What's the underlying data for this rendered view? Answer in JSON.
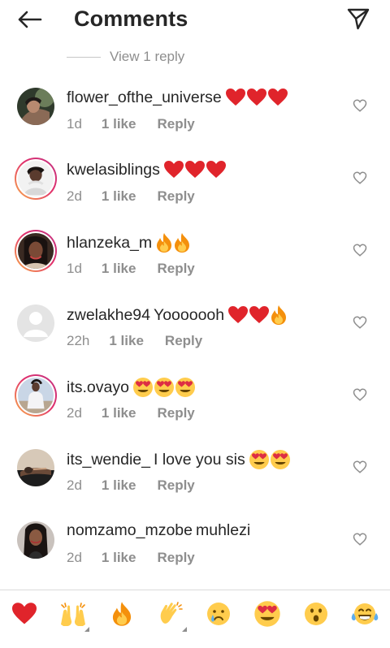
{
  "header": {
    "title": "Comments"
  },
  "view_replies": {
    "label": "View 1 reply"
  },
  "comments": [
    {
      "username": "flower_ofthe_universe",
      "text": "",
      "emojis": [
        "red-heart",
        "red-heart",
        "red-heart"
      ],
      "time": "1d",
      "likes": "1 like",
      "reply": "Reply",
      "avatar_ring": false
    },
    {
      "username": "kwelasiblings",
      "text": "",
      "emojis": [
        "red-heart",
        "red-heart",
        "red-heart"
      ],
      "time": "2d",
      "likes": "1 like",
      "reply": "Reply",
      "avatar_ring": true
    },
    {
      "username": "hlanzeka_m",
      "text": "",
      "emojis": [
        "fire",
        "fire"
      ],
      "time": "1d",
      "likes": "1 like",
      "reply": "Reply",
      "avatar_ring": true
    },
    {
      "username": "zwelakhe94",
      "text": "Yooooooh",
      "emojis": [
        "red-heart",
        "red-heart",
        "fire"
      ],
      "time": "22h",
      "likes": "1 like",
      "reply": "Reply",
      "avatar_ring": false
    },
    {
      "username": "its.ovayo",
      "text": "",
      "emojis": [
        "heart-eyes",
        "heart-eyes",
        "heart-eyes"
      ],
      "time": "2d",
      "likes": "1 like",
      "reply": "Reply",
      "avatar_ring": true
    },
    {
      "username": "its_wendie_",
      "text": "I love you sis",
      "emojis": [
        "heart-eyes",
        "heart-eyes"
      ],
      "time": "2d",
      "likes": "1 like",
      "reply": "Reply",
      "avatar_ring": false
    },
    {
      "username": "nomzamo_mzobe",
      "text": "muhlezi",
      "emojis": [],
      "time": "2d",
      "likes": "1 like",
      "reply": "Reply",
      "avatar_ring": false
    }
  ],
  "quick_reactions": [
    "red-heart-icon",
    "raising-hands-icon",
    "fire-icon",
    "clapping-hands-icon",
    "crying-face-icon",
    "heart-eyes-icon",
    "surprised-face-icon",
    "tears-of-joy-icon"
  ],
  "colors": {
    "text": "#262626",
    "secondary": "#8e8e8e",
    "heart": "#ed4956",
    "divider": "#dbdbdb"
  }
}
